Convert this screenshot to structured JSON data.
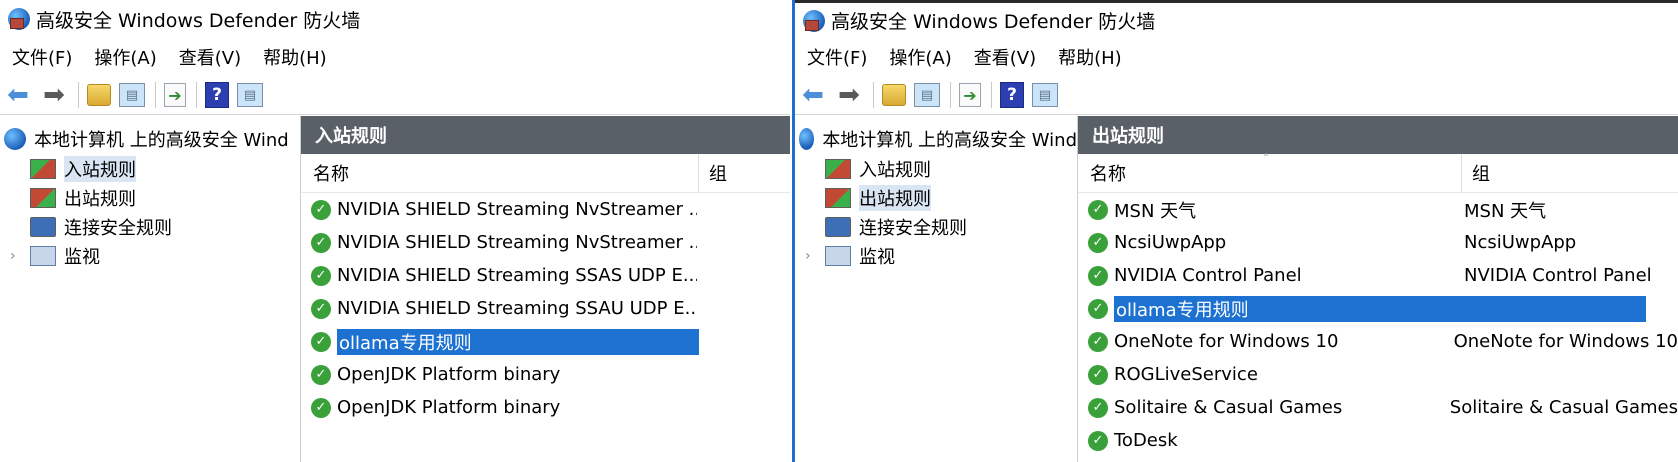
{
  "left_window": {
    "title": "高级安全 Windows Defender 防火墙",
    "menu": [
      "文件(F)",
      "操作(A)",
      "查看(V)",
      "帮助(H)"
    ],
    "tree_root": "本地计算机 上的高级安全 Wind",
    "tree_items": [
      {
        "label": "入站规则",
        "icon": "inbound-rules-icon"
      },
      {
        "label": "出站规则",
        "icon": "outbound-rules-icon"
      },
      {
        "label": "连接安全规则",
        "icon": "connection-security-icon"
      },
      {
        "label": "监视",
        "icon": "monitor-icon"
      }
    ],
    "selected_tree_index": 0,
    "panel_title": "入站规则",
    "col_name": "名称",
    "col_group": "组",
    "rows": [
      {
        "name": "NVIDIA SHIELD Streaming NvStreamer ..."
      },
      {
        "name": "NVIDIA SHIELD Streaming NvStreamer ..."
      },
      {
        "name": "NVIDIA SHIELD Streaming SSAS UDP E..."
      },
      {
        "name": "NVIDIA SHIELD Streaming SSAU UDP E..."
      },
      {
        "name": "ollama专用规则"
      },
      {
        "name": "OpenJDK Platform binary"
      },
      {
        "name": "OpenJDK Platform binary"
      }
    ]
  },
  "right_window": {
    "title": "高级安全 Windows Defender 防火墙",
    "menu": [
      "文件(F)",
      "操作(A)",
      "查看(V)",
      "帮助(H)"
    ],
    "tree_root": "本地计算机 上的高级安全 Wind",
    "tree_items": [
      {
        "label": "入站规则",
        "icon": "inbound-rules-icon"
      },
      {
        "label": "出站规则",
        "icon": "outbound-rules-icon"
      },
      {
        "label": "连接安全规则",
        "icon": "connection-security-icon"
      },
      {
        "label": "监视",
        "icon": "monitor-icon"
      }
    ],
    "panel_title": "出站规则",
    "col_name": "名称",
    "col_group": "组",
    "rows": [
      {
        "name": "MSN 天气",
        "group": "MSN 天气"
      },
      {
        "name": "NcsiUwpApp",
        "group": "NcsiUwpApp"
      },
      {
        "name": "NVIDIA Control Panel",
        "group": "NVIDIA Control Panel"
      },
      {
        "name": "ollama专用规则",
        "group": ""
      },
      {
        "name": "OneNote for Windows 10",
        "group": "OneNote for Windows 10"
      },
      {
        "name": "ROGLiveService",
        "group": ""
      },
      {
        "name": "Solitaire & Casual Games",
        "group": "Solitaire & Casual Games"
      },
      {
        "name": "ToDesk",
        "group": ""
      }
    ]
  },
  "colors": {
    "selection": "#1d72d1",
    "header_bar": "#5a6068",
    "check": "#3aa13a"
  }
}
